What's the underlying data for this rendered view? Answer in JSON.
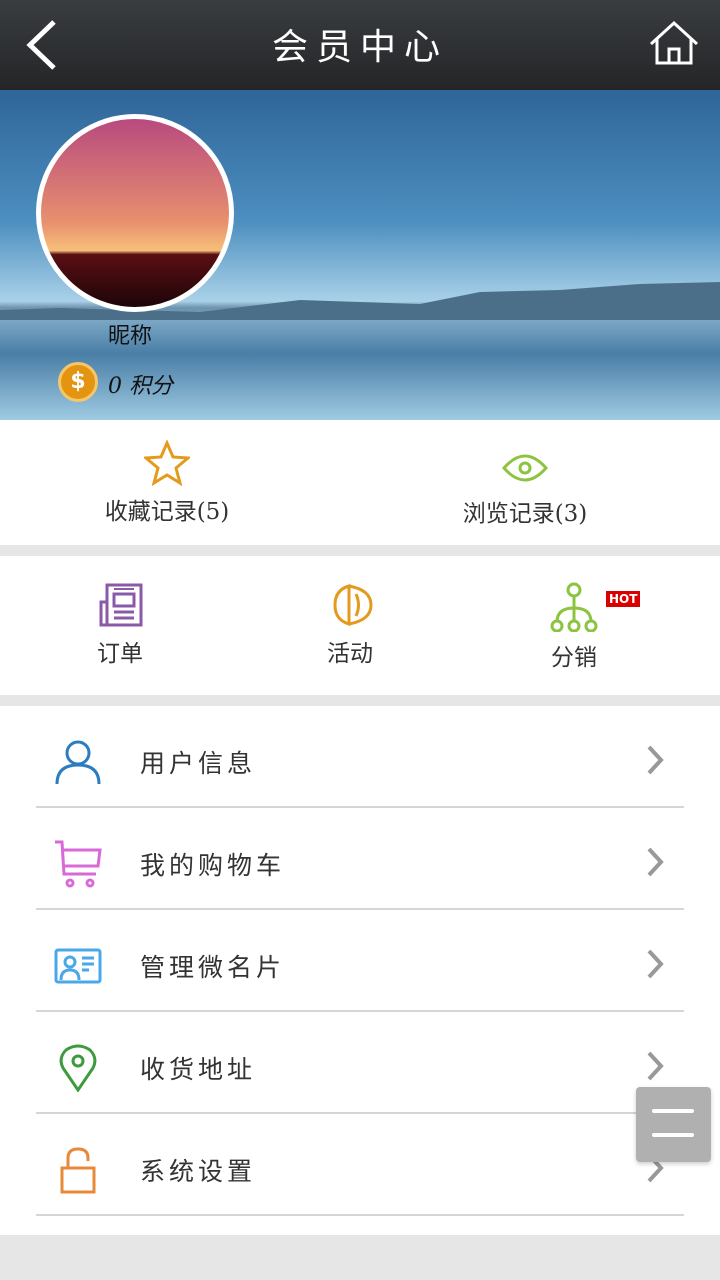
{
  "header": {
    "title": "会员中心",
    "back_icon": "chevron-left-icon",
    "home_icon": "home-icon"
  },
  "profile": {
    "nickname": "昵称",
    "points": "0 积分",
    "coin_symbol": "$"
  },
  "quick": [
    {
      "label": "收藏记录(5)",
      "icon": "star-icon",
      "color": "#e39a1d"
    },
    {
      "label": "浏览记录(3)",
      "icon": "eye-icon",
      "color": "#8cc43f"
    }
  ],
  "functions": [
    {
      "label": "订单",
      "icon": "order-icon",
      "color": "#8a5aa8"
    },
    {
      "label": "活动",
      "icon": "speaker-icon",
      "color": "#e39a1d"
    },
    {
      "label": "分销",
      "icon": "network-icon",
      "color": "#8cc43f",
      "badge": "HOT"
    }
  ],
  "menu": [
    {
      "label": "用户信息",
      "icon": "user-icon",
      "color": "#2b7cc0"
    },
    {
      "label": "我的购物车",
      "icon": "cart-icon",
      "color": "#d86ad8"
    },
    {
      "label": "管理微名片",
      "icon": "card-icon",
      "color": "#4aa8e8"
    },
    {
      "label": "收货地址",
      "icon": "location-icon",
      "color": "#3d9a3d"
    },
    {
      "label": "系统设置",
      "icon": "lock-icon",
      "color": "#e8893a"
    }
  ]
}
